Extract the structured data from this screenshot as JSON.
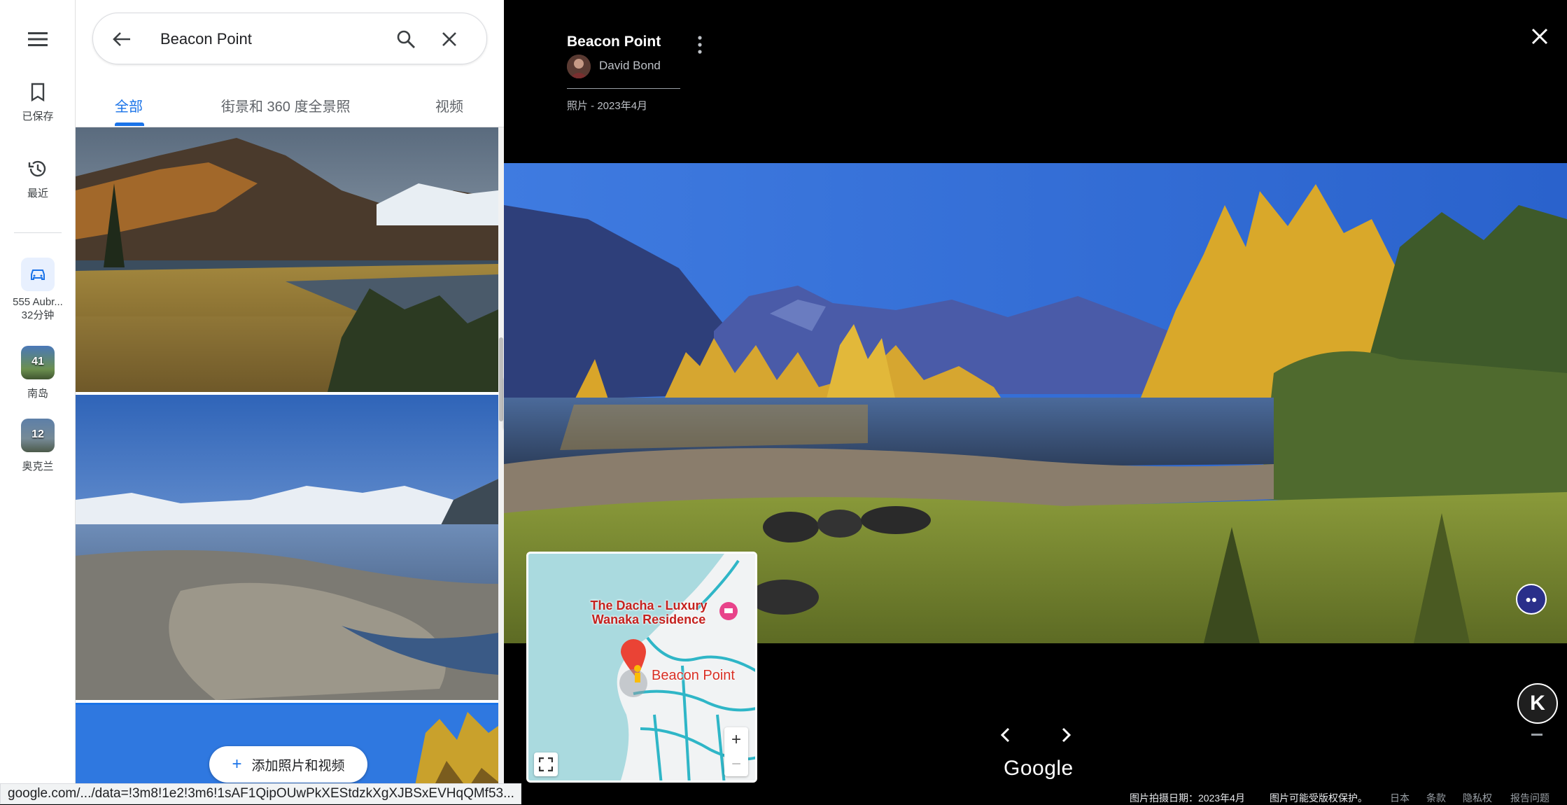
{
  "rail": {
    "menu_icon": "menu-icon",
    "saved_label": "已保存",
    "recent_label": "最近",
    "trip": {
      "label": "555 Aubr...",
      "sub": "32分钟"
    },
    "list1": {
      "count": "41",
      "label": "南岛"
    },
    "list2": {
      "count": "12",
      "label": "奥克兰"
    }
  },
  "search": {
    "query": "Beacon Point"
  },
  "tabs": [
    {
      "label": "全部"
    },
    {
      "label": "街景和 360 度全景照"
    },
    {
      "label": "视频"
    }
  ],
  "add_button": {
    "label": "添加照片和视频"
  },
  "viewer": {
    "title": "Beacon Point",
    "author": "David Bond",
    "date": "照片 - 2023年4月",
    "brand": "Google",
    "badge": "K"
  },
  "minimap": {
    "poi": "The Dacha - Luxury Wanaka Residence",
    "place": "Beacon Point",
    "accent": "#d93025"
  },
  "footer": {
    "capture_date": "图片拍摄日期：2023年4月",
    "copyright": "图片可能受版权保护。",
    "region": "日本",
    "terms": "条款",
    "privacy": "隐私权",
    "report": "报告问题"
  },
  "status_url": "google.com/.../data=!3m8!1e2!3m6!1sAF1QipOUwPkXEStdzkXgXJBSxEVHqQMf53..."
}
